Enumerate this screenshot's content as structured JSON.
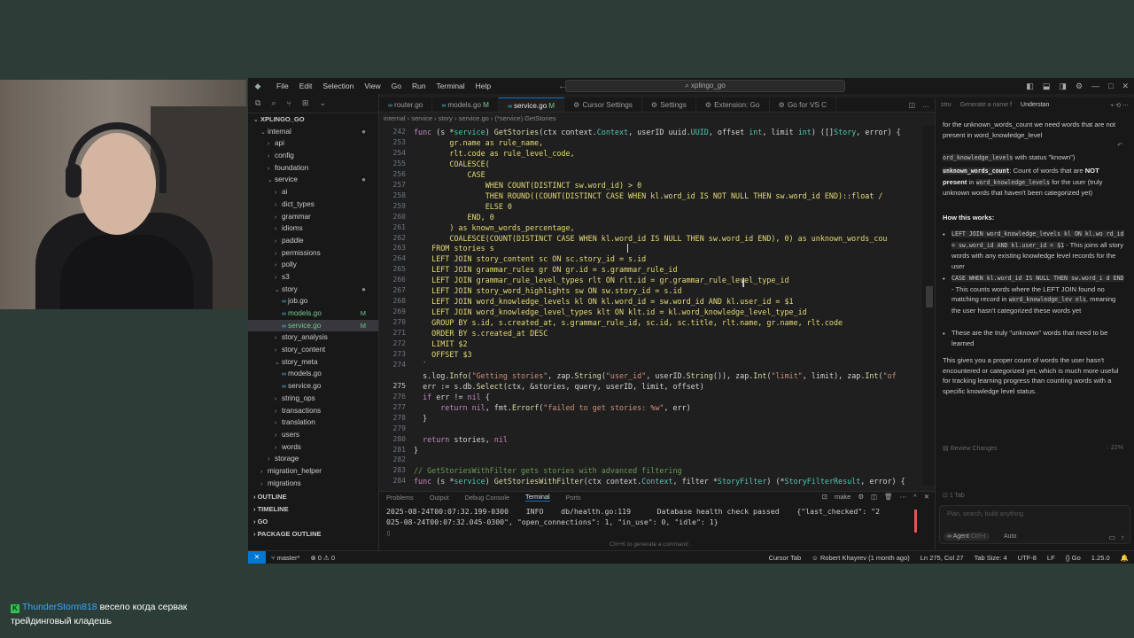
{
  "window": {
    "title": "xplingo_go",
    "menu": [
      "File",
      "Edit",
      "Selection",
      "View",
      "Go",
      "Run",
      "Terminal",
      "Help"
    ]
  },
  "sidebar": {
    "root": "XPLINGO_GO",
    "items": [
      {
        "label": "internal",
        "depth": 1,
        "chev": "⌄",
        "marker": "●"
      },
      {
        "label": "api",
        "depth": 2,
        "chev": "›"
      },
      {
        "label": "config",
        "depth": 2,
        "chev": "›"
      },
      {
        "label": "foundation",
        "depth": 2,
        "chev": "›"
      },
      {
        "label": "service",
        "depth": 2,
        "chev": "⌄",
        "marker": "●"
      },
      {
        "label": "ai",
        "depth": 3,
        "chev": "›"
      },
      {
        "label": "dict_types",
        "depth": 3,
        "chev": "›"
      },
      {
        "label": "grammar",
        "depth": 3,
        "chev": "›"
      },
      {
        "label": "idioms",
        "depth": 3,
        "chev": "›"
      },
      {
        "label": "paddle",
        "depth": 3,
        "chev": "›"
      },
      {
        "label": "permissions",
        "depth": 3,
        "chev": "›"
      },
      {
        "label": "polly",
        "depth": 3,
        "chev": "›"
      },
      {
        "label": "s3",
        "depth": 3,
        "chev": "›"
      },
      {
        "label": "story",
        "depth": 3,
        "chev": "⌄",
        "marker": "●"
      },
      {
        "label": "job.go",
        "depth": 4,
        "file": true
      },
      {
        "label": "models.go",
        "depth": 4,
        "file": true,
        "badge": "M"
      },
      {
        "label": "service.go",
        "depth": 4,
        "file": true,
        "badge": "M",
        "selected": true
      },
      {
        "label": "story_analysis",
        "depth": 3,
        "chev": "›"
      },
      {
        "label": "story_content",
        "depth": 3,
        "chev": "›"
      },
      {
        "label": "story_meta",
        "depth": 3,
        "chev": "⌄"
      },
      {
        "label": "models.go",
        "depth": 4,
        "file": true
      },
      {
        "label": "service.go",
        "depth": 4,
        "file": true
      },
      {
        "label": "string_ops",
        "depth": 3,
        "chev": "›"
      },
      {
        "label": "transactions",
        "depth": 3,
        "chev": "›"
      },
      {
        "label": "translation",
        "depth": 3,
        "chev": "›"
      },
      {
        "label": "users",
        "depth": 3,
        "chev": "›"
      },
      {
        "label": "words",
        "depth": 3,
        "chev": "›"
      },
      {
        "label": "storage",
        "depth": 2,
        "chev": "›"
      },
      {
        "label": "migration_helper",
        "depth": 1,
        "chev": "›"
      },
      {
        "label": "migrations",
        "depth": 1,
        "chev": "›"
      }
    ],
    "sections": [
      "OUTLINE",
      "TIMELINE",
      "GO",
      "PACKAGE OUTLINE"
    ]
  },
  "tabs": [
    {
      "label": "router.go",
      "go": true
    },
    {
      "label": "models.go",
      "go": true,
      "badge": "M"
    },
    {
      "label": "service.go",
      "go": true,
      "badge": "M",
      "active": true
    },
    {
      "label": "Cursor Settings"
    },
    {
      "label": "Settings"
    },
    {
      "label": "Extension: Go"
    },
    {
      "label": "Go for VS C"
    }
  ],
  "breadcrumb": "internal › service › story › service.go › (*service).GetStories",
  "editor": {
    "current_line": "275",
    "lines": [
      {
        "n": "242",
        "h": "<span class='kw'>func</span> (s *<span class='ty'>service</span>) <span class='fn'>GetStories</span>(ctx context.<span class='ty'>Context</span>, userID uuid.<span class='ty'>UUID</span>, offset <span class='ty'>int</span>, limit <span class='ty'>int</span>) ([]<span class='ty'>Story</span>, error) {"
      },
      {
        "n": "253",
        "h": "        <span class='sq'>gr.name as rule_name,</span>"
      },
      {
        "n": "254",
        "h": "        <span class='sq'>rlt.code as rule_level_code,</span>"
      },
      {
        "n": "255",
        "h": "        <span class='sq'>COALESCE(</span>"
      },
      {
        "n": "256",
        "h": "            <span class='sq'>CASE</span>"
      },
      {
        "n": "257",
        "h": "                <span class='sq'>WHEN COUNT(DISTINCT sw.word_id) &gt; 0</span>"
      },
      {
        "n": "258",
        "h": "                <span class='sq'>THEN ROUND((COUNT(DISTINCT CASE WHEN kl.word_id IS NOT NULL THEN sw.word_id END)::float /</span>"
      },
      {
        "n": "259",
        "h": "                <span class='sq'>ELSE 0</span>"
      },
      {
        "n": "260",
        "h": "            <span class='sq'>END, 0</span>"
      },
      {
        "n": "261",
        "h": "        <span class='sq'>) as known_words_percentage,</span>"
      },
      {
        "n": "262",
        "h": "        <span class='sq'>COALESCE(COUNT(DISTINCT CASE WHEN kl.word_id IS NULL THEN sw.word_id END), 0) as unknown_words_cou</span>"
      },
      {
        "n": "263",
        "h": "    <span class='sq'>FROM stories s</span>"
      },
      {
        "n": "264",
        "h": "    <span class='sq'>LEFT JOIN story_content sc ON sc.story_id = s.id</span>"
      },
      {
        "n": "265",
        "h": "    <span class='sq'>LEFT JOIN grammar_rules gr ON gr.id = s.grammar_rule_id</span>"
      },
      {
        "n": "266",
        "h": "    <span class='sq'>LEFT JOIN grammar_rule_level_types rlt ON rlt.id = gr.grammar_rule_level_type_id</span>"
      },
      {
        "n": "267",
        "h": "    <span class='sq'>LEFT JOIN story_word_highlights sw ON sw.story_id = s.id</span>"
      },
      {
        "n": "268",
        "h": "    <span class='sq'>LEFT JOIN word_knowledge_levels kl ON kl.word_id = sw.word_id AND kl.user_id = $1</span>"
      },
      {
        "n": "269",
        "h": "    <span class='sq'>LEFT JOIN word_knowledge_level_types klt ON klt.id = kl.word_knowledge_level_type_id</span>"
      },
      {
        "n": "270",
        "h": "    <span class='sq'>GROUP BY s.id, s.created_at, s.grammar_rule_id, sc.id, sc.title, rlt.name, gr.name, rlt.code</span>"
      },
      {
        "n": "271",
        "h": "    <span class='sq'>ORDER BY s.created_at DESC</span>"
      },
      {
        "n": "272",
        "h": "    <span class='sq'>LIMIT $2</span>"
      },
      {
        "n": "273",
        "h": "    <span class='sq'>OFFSET $3</span>"
      },
      {
        "n": "274",
        "h": "  <span class='st'>`</span>"
      },
      {
        "n": "",
        "h": "  s.log.<span class='fn'>Info</span>(<span class='st'>\"Getting stories\"</span>, zap.<span class='fn'>String</span>(<span class='st'>\"user_id\"</span>, userID.<span class='fn'>String</span>()), zap.<span class='fn'>Int</span>(<span class='st'>\"limit\"</span>, limit), zap.<span class='fn'>Int</span>(<span class='st'>\"of</span>"
      },
      {
        "n": "275",
        "h": "  err := s.db.<span class='fn'>Select</span>(ctx, &amp;stories, query, userID, limit, offset)"
      },
      {
        "n": "276",
        "h": "  <span class='kw'>if</span> err != <span class='kw'>nil</span> {"
      },
      {
        "n": "277",
        "h": "      <span class='kw'>return</span> <span class='kw'>nil</span>, fmt.<span class='fn'>Errorf</span>(<span class='st'>\"failed to get stories: %w\"</span>, err)"
      },
      {
        "n": "278",
        "h": "  }"
      },
      {
        "n": "279",
        "h": ""
      },
      {
        "n": "280",
        "h": "  <span class='kw'>return</span> stories, <span class='kw'>nil</span>"
      },
      {
        "n": "281",
        "h": "}"
      },
      {
        "n": "282",
        "h": ""
      },
      {
        "n": "283",
        "h": "<span class='cm'>// GetStoriesWithFilter gets stories with advanced filtering</span>"
      },
      {
        "n": "284",
        "h": "<span class='kw'>func</span> (s *<span class='ty'>service</span>) <span class='fn'>GetStoriesWithFilter</span>(ctx context.<span class='ty'>Context</span>, filter *<span class='ty'>StoryFilter</span>) (*<span class='ty'>StoryFilterResult</span>, error) {"
      }
    ]
  },
  "panel": {
    "tabs": [
      "Problems",
      "Output",
      "Debug Console",
      "Terminal",
      "Ports"
    ],
    "active_tab": "Terminal",
    "task": "make",
    "lines": [
      "2025-08-24T00:07:32.199-0300    INFO    db/health.go:119      Database health check passed    {\"last_checked\": \"2",
      "025-08-24T00:07:32.045-0300\", \"open_connections\": 1, \"in_use\": 0, \"idle\": 1}"
    ],
    "hint": "Ctrl+K to generate a command"
  },
  "chat": {
    "tabs": [
      "stru",
      "Generate a name f",
      "Understan"
    ],
    "review": "Review Changes",
    "progress": "22%",
    "tab_count": "1 Tab",
    "placeholder": "Plan, search, build anything",
    "mode": "Agent",
    "mode_key": "Ctrl+I",
    "model": "Auto"
  },
  "status": {
    "branch": "master*",
    "problems": "⊗ 0 ⚠ 0",
    "cursor_tab": "Cursor Tab",
    "blame": "Robert Khayrev (1 month ago)",
    "position": "Ln 275, Col 27",
    "tab_size": "Tab Size: 4",
    "encoding": "UTF-8",
    "eol": "LF",
    "lang": "{} Go",
    "go_version": "1.25.0"
  },
  "stream_chat": {
    "user": "ThunderStorm818",
    "message_part1": "весело когда сервак",
    "message_part2": "трейдинговый кладешь"
  }
}
